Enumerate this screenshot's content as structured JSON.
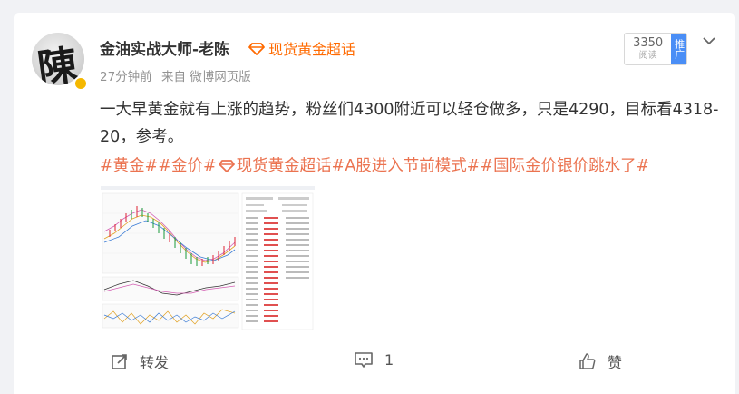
{
  "post": {
    "author": "金油实战大师-老陈",
    "avatar_glyph": "陳",
    "super_topic": "现货黄金超话",
    "time": "27分钟前",
    "source": "来自 微博网页版",
    "text": "一大早黄金就有上涨的趋势，粉丝们4300附近可以轻仓做多，只是4290，目标看4318-20，参考。",
    "tags": [
      {
        "text": "#黄金#",
        "icon": false
      },
      {
        "text": "#金价#",
        "icon": false
      },
      {
        "text": "现货黄金超话",
        "icon": true
      },
      {
        "text": "#A股进入节前模式#",
        "icon": false
      },
      {
        "text": "#国际金价银价跳水了#",
        "icon": false
      }
    ]
  },
  "stats": {
    "read_count": "3350",
    "read_label": "阅读",
    "promote_label": "推广"
  },
  "actions": {
    "repost_label": "转发",
    "comment_count": "1",
    "like_label": "赞"
  },
  "colors": {
    "accent_orange": "#ff6a00",
    "tag_color": "#eb7350",
    "promote_blue": "#4a8ef6"
  },
  "icons": [
    "diamond-icon",
    "chevron-down-icon",
    "repost-icon",
    "comment-icon",
    "like-icon"
  ]
}
